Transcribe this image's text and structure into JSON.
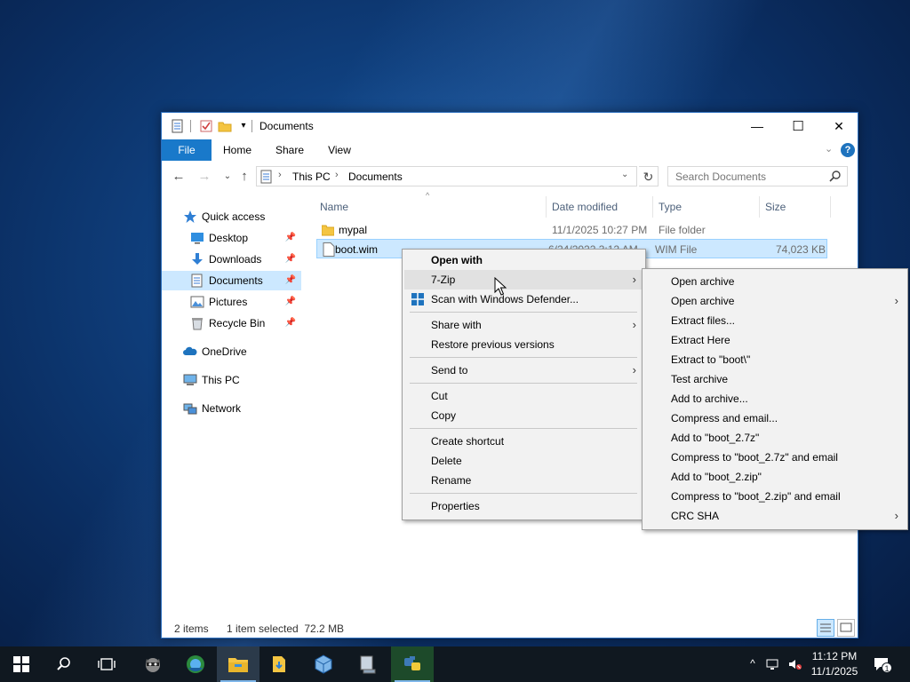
{
  "window": {
    "title": "Documents",
    "controls": {
      "minimize": "—",
      "maximize": "☐",
      "close": "✕"
    }
  },
  "ribbon": {
    "tabs": [
      "File",
      "Home",
      "Share",
      "View"
    ],
    "help": "?"
  },
  "address": {
    "segments": [
      "This PC",
      "Documents"
    ],
    "search_placeholder": "Search Documents"
  },
  "nav": {
    "items": [
      {
        "label": "Quick access",
        "icon": "star-icon"
      },
      {
        "label": "Desktop",
        "icon": "desktop-icon",
        "pinned": true
      },
      {
        "label": "Downloads",
        "icon": "download-icon",
        "pinned": true
      },
      {
        "label": "Documents",
        "icon": "documents-icon",
        "pinned": true,
        "selected": true
      },
      {
        "label": "Pictures",
        "icon": "pictures-icon",
        "pinned": true
      },
      {
        "label": "Recycle Bin",
        "icon": "recycle-bin-icon",
        "pinned": true
      },
      {
        "label": "OneDrive",
        "icon": "cloud-icon"
      },
      {
        "label": "This PC",
        "icon": "computer-icon"
      },
      {
        "label": "Network",
        "icon": "network-icon"
      }
    ]
  },
  "files": {
    "columns": [
      "Name",
      "Date modified",
      "Type",
      "Size"
    ],
    "rows": [
      {
        "name": "mypal",
        "date": "11/1/2025 10:27 PM",
        "type": "File folder",
        "size": "",
        "icon": "folder-icon"
      },
      {
        "name": "boot.wim",
        "date": "6/24/2022 3:12 AM",
        "type": "WIM File",
        "size": "74,023 KB",
        "icon": "file-icon",
        "selected": true
      }
    ]
  },
  "status": {
    "count": "2 items",
    "selection": "1 item selected  72.2 MB"
  },
  "context_menu": {
    "items": {
      "open_with": "Open with",
      "seven_zip": "7-Zip",
      "defender": "Scan with Windows Defender...",
      "share_with": "Share with",
      "restore": "Restore previous versions",
      "send_to": "Send to",
      "cut": "Cut",
      "copy": "Copy",
      "create_shortcut": "Create shortcut",
      "delete": "Delete",
      "rename": "Rename",
      "properties": "Properties"
    },
    "arrow": "›"
  },
  "submenu_7zip": {
    "items": [
      {
        "label": "Open archive",
        "arrow": false
      },
      {
        "label": "Open archive",
        "arrow": true
      },
      {
        "label": "Extract files...",
        "arrow": false
      },
      {
        "label": "Extract Here",
        "arrow": false
      },
      {
        "label": "Extract to \"boot\\\"",
        "arrow": false
      },
      {
        "label": "Test archive",
        "arrow": false
      },
      {
        "label": "Add to archive...",
        "arrow": false
      },
      {
        "label": "Compress and email...",
        "arrow": false
      },
      {
        "label": "Add to \"boot_2.7z\"",
        "arrow": false
      },
      {
        "label": "Compress to \"boot_2.7z\" and email",
        "arrow": false
      },
      {
        "label": "Add to \"boot_2.zip\"",
        "arrow": false
      },
      {
        "label": "Compress to \"boot_2.zip\" and email",
        "arrow": false
      },
      {
        "label": "CRC SHA",
        "arrow": true
      }
    ]
  },
  "taskbar": {
    "apps": [
      "start-icon",
      "search-icon",
      "task-view-icon",
      "raccoon-app-icon",
      "globe-browser-icon",
      "file-explorer-icon",
      "folder-download-icon",
      "virtualbox-icon",
      "computer-setup-icon",
      "python-icon"
    ],
    "time": "11:12 PM",
    "date": "11/1/2025",
    "notifications": "1"
  },
  "colors": {
    "accent": "#1979ca",
    "selection": "#cce8ff",
    "menu_bg": "#f2f2f2",
    "taskbar": "#101820"
  }
}
